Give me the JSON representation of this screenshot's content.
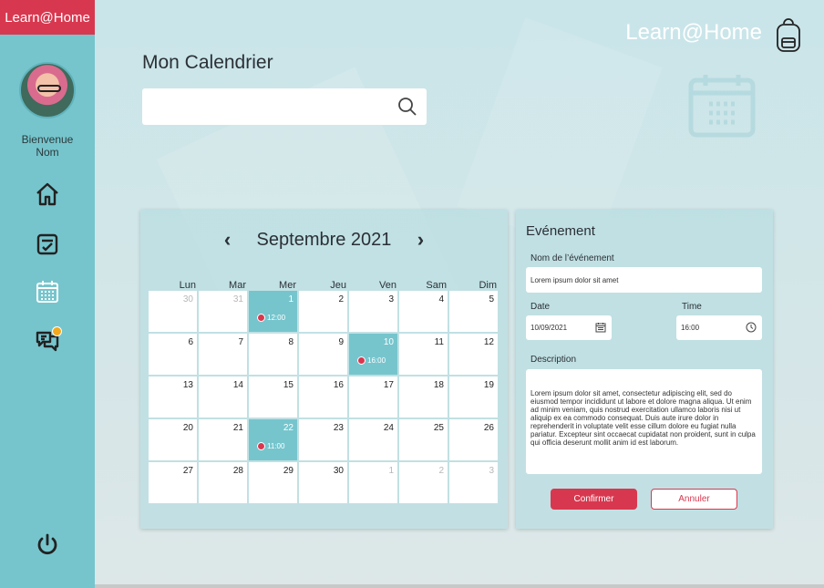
{
  "sidebar": {
    "logo": "Learn@Home",
    "welcome_line1": "Bienvenue",
    "welcome_line2": "Nom",
    "nav": [
      "home-icon",
      "tasks-icon",
      "calendar-icon",
      "chat-icon"
    ],
    "logout_icon": "power-icon",
    "accent": "#d8384f",
    "bg": "#76c5cd"
  },
  "header": {
    "brand": "Learn@Home",
    "title": "Mon Calendrier",
    "search_placeholder": ""
  },
  "calendar": {
    "month_label": "Septembre 2021",
    "prev": "‹",
    "next": "›",
    "weekdays": [
      "Lun",
      "Mar",
      "Mer",
      "Jeu",
      "Ven",
      "Sam",
      "Dim"
    ],
    "weeks": [
      [
        {
          "d": "30",
          "muted": true
        },
        {
          "d": "31",
          "muted": true
        },
        {
          "d": "1",
          "event": "12:00"
        },
        {
          "d": "2"
        },
        {
          "d": "3"
        },
        {
          "d": "4"
        },
        {
          "d": "5"
        }
      ],
      [
        {
          "d": "6"
        },
        {
          "d": "7"
        },
        {
          "d": "8"
        },
        {
          "d": "9"
        },
        {
          "d": "10",
          "event": "16:00"
        },
        {
          "d": "11"
        },
        {
          "d": "12"
        }
      ],
      [
        {
          "d": "13"
        },
        {
          "d": "14"
        },
        {
          "d": "15"
        },
        {
          "d": "16"
        },
        {
          "d": "17"
        },
        {
          "d": "18"
        },
        {
          "d": "19"
        }
      ],
      [
        {
          "d": "20"
        },
        {
          "d": "21"
        },
        {
          "d": "22",
          "event": "11:00"
        },
        {
          "d": "23"
        },
        {
          "d": "24"
        },
        {
          "d": "25"
        },
        {
          "d": "26"
        }
      ],
      [
        {
          "d": "27"
        },
        {
          "d": "28"
        },
        {
          "d": "29"
        },
        {
          "d": "30"
        },
        {
          "d": "1",
          "muted": true
        },
        {
          "d": "2",
          "muted": true
        },
        {
          "d": "3",
          "muted": true
        }
      ]
    ],
    "event_color": "#76c5cd",
    "dot_color": "#d8384f"
  },
  "event_form": {
    "title": "Evénement",
    "name_label": "Nom de l’événement",
    "name_value": "Lorem ipsum dolor sit amet",
    "date_label": "Date",
    "date_value": "10/09/2021",
    "time_label": "Time",
    "time_value": "16:00",
    "description_label": "Description",
    "description_value": "Lorem ipsum dolor sit amet, consectetur adipiscing elit, sed do eiusmod tempor incididunt ut labore et dolore magna aliqua. Ut enim ad minim veniam, quis nostrud exercitation ullamco laboris nisi ut aliquip ex ea commodo consequat. Duis aute irure dolor in reprehenderit in voluptate velit esse cillum dolore eu fugiat nulla pariatur. Excepteur sint occaecat cupidatat non proident, sunt in culpa qui officia deserunt mollit anim id est laborum.",
    "confirm_label": "Confirmer",
    "cancel_label": "Annuler"
  }
}
